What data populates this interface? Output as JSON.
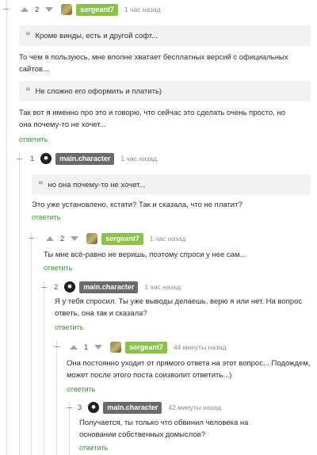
{
  "comments": [
    {
      "author": "sergeant7",
      "rating": "2",
      "time": "1 час назад",
      "quote": "Кроме винды, есть и другой софт...",
      "text": "То чем я пользуюсь, мне вполне хватает бесплатных версий с официальных сайтов..."
    },
    {
      "quote": "Не сложно его оформить и платить)",
      "text": "Так вот я именно про это и говорю, что сейчас это сделать очень просто, но она почему-то не хочет...",
      "reply": "ответить"
    },
    {
      "author": "main.character",
      "rating": "1",
      "time": "1 час назад",
      "quote": "но она почему-то не хочет...",
      "text": "Это уже установлено, кстати? Так и сказала, что не платит?",
      "reply": "ответить"
    },
    {
      "author": "sergeant7",
      "rating": "2",
      "time": "1 час назад",
      "text": "Ты мне всё-равно не веришь, поэтому спроси у нее сам...",
      "reply": "ответить"
    },
    {
      "author": "main.character",
      "rating": "2",
      "time": "1 час назад",
      "text": "Я у тебя спросил. Ты уже выводы делаешь, верю я или нет. На вопрос ответь, она так и сказала?",
      "reply": "ответить"
    },
    {
      "author": "sergeant7",
      "rating": "1",
      "time": "44 минуты назад",
      "text": "Она постоянно уходит от прямого ответа на этот вопрос... Подождем, может после этого поста соизволит ответить...)",
      "reply": "ответить"
    },
    {
      "author": "main.character",
      "rating": "3",
      "time": "42 минуты назад",
      "text": "Получается, ты только что обвинил человека на основании собственных домыслов?",
      "reply": "ответить"
    }
  ]
}
